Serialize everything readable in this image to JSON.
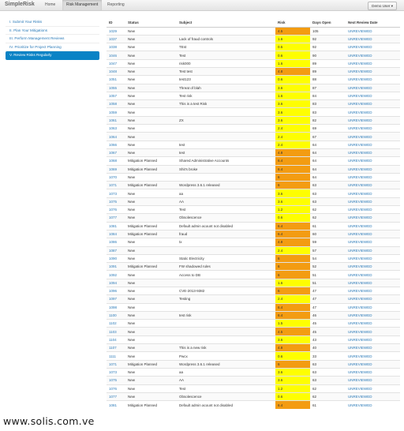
{
  "navbar": {
    "brand": "SimpleRisk",
    "tabs": [
      "Home",
      "Risk Management",
      "Reporting"
    ],
    "active_tab": "Risk Management",
    "user_button": "Demo User"
  },
  "sidebar": {
    "items": [
      {
        "label": "I. Submit Your Risks",
        "active": false
      },
      {
        "label": "II. Plan Your Mitigations",
        "active": false
      },
      {
        "label": "III. Perform Management Reviews",
        "active": false
      },
      {
        "label": "IV. Prioritize for Project Planning",
        "active": false
      },
      {
        "label": "V. Review Risks Regularly",
        "active": true
      }
    ]
  },
  "table": {
    "columns": [
      "ID",
      "Status",
      "Subject",
      "Risk",
      "Days Open",
      "Next Review Date"
    ],
    "rows": [
      [
        "1029",
        "New",
        "",
        "4.5",
        "105",
        "UNREVIEWED"
      ],
      [
        "1037",
        "New",
        "Lack of fraud controls",
        "1.6",
        "92",
        "UNREVIEWED"
      ],
      [
        "1038",
        "New",
        "TEst",
        "0.5",
        "92",
        "UNREVIEWED"
      ],
      [
        "1046",
        "New",
        "Test",
        "0.6",
        "90",
        "UNREVIEWED"
      ],
      [
        "1047",
        "New",
        "risk000",
        "1.6",
        "89",
        "UNREVIEWED"
      ],
      [
        "1048",
        "New",
        "Test test",
        "4.8",
        "89",
        "UNREVIEWED"
      ],
      [
        "1051",
        "New",
        "test123",
        "0.6",
        "88",
        "UNREVIEWED"
      ],
      [
        "1055",
        "New",
        "Threat of blah",
        "3.6",
        "87",
        "UNREVIEWED"
      ],
      [
        "1057",
        "New",
        "Test risk",
        "1.6",
        "84",
        "UNREVIEWED"
      ],
      [
        "1058",
        "New",
        "This is a test Risk",
        "3.6",
        "83",
        "UNREVIEWED"
      ],
      [
        "1059",
        "New",
        "",
        "3.6",
        "83",
        "UNREVIEWED"
      ],
      [
        "1061",
        "New",
        "ZX",
        "3.6",
        "82",
        "UNREVIEWED"
      ],
      [
        "1063",
        "New",
        "",
        "2.4",
        "69",
        "UNREVIEWED"
      ],
      [
        "1064",
        "New",
        "",
        "2.4",
        "67",
        "UNREVIEWED"
      ],
      [
        "1066",
        "New",
        "test",
        "2.4",
        "64",
        "UNREVIEWED"
      ],
      [
        "1067",
        "New",
        "test",
        "4.8",
        "64",
        "UNREVIEWED"
      ],
      [
        "1068",
        "Mitigation Planned",
        "Shared Administrative Accounts",
        "6.4",
        "64",
        "UNREVIEWED"
      ],
      [
        "1069",
        "Mitigation Planned",
        "Shit's broke",
        "6.4",
        "64",
        "UNREVIEWED"
      ],
      [
        "1070",
        "New",
        "",
        "6",
        "64",
        "UNREVIEWED"
      ],
      [
        "1071",
        "Mitigation Planned",
        "Wordpress 3.6.1 released",
        "6",
        "63",
        "UNREVIEWED"
      ],
      [
        "1073",
        "New",
        "aa",
        "3.6",
        "63",
        "UNREVIEWED"
      ],
      [
        "1075",
        "New",
        "AA",
        "3.6",
        "63",
        "UNREVIEWED"
      ],
      [
        "1076",
        "New",
        "Test",
        "1.2",
        "62",
        "UNREVIEWED"
      ],
      [
        "1077",
        "New",
        "Obsolescence",
        "0.6",
        "62",
        "UNREVIEWED"
      ],
      [
        "1081",
        "Mitigation Planned",
        "Default admin acount not disabled",
        "6.4",
        "61",
        "UNREVIEWED"
      ],
      [
        "1084",
        "Mitigation Planned",
        "fraud",
        "6.4",
        "60",
        "UNREVIEWED"
      ],
      [
        "1086",
        "New",
        "tx",
        "4.8",
        "59",
        "UNREVIEWED"
      ],
      [
        "1087",
        "New",
        "",
        "2.4",
        "57",
        "UNREVIEWED"
      ],
      [
        "1090",
        "New",
        "Static Electricity",
        "6",
        "54",
        "UNREVIEWED"
      ],
      [
        "1091",
        "Mitigation Planned",
        "FW shadowed rules",
        "6",
        "52",
        "UNREVIEWED"
      ],
      [
        "1092",
        "New",
        "Access to DB",
        "6",
        "51",
        "UNREVIEWED"
      ],
      [
        "1094",
        "New",
        "",
        "1.6",
        "51",
        "UNREVIEWED"
      ],
      [
        "1096",
        "New",
        "CVE-2013-9382",
        "6",
        "47",
        "UNREVIEWED"
      ],
      [
        "1097",
        "New",
        "Testing",
        "2.4",
        "47",
        "UNREVIEWED"
      ],
      [
        "1098",
        "New",
        "",
        "6.4",
        "47",
        "UNREVIEWED"
      ],
      [
        "1100",
        "New",
        "test risk",
        "6.4",
        "46",
        "UNREVIEWED"
      ],
      [
        "1102",
        "New",
        "",
        "1.5",
        "45",
        "UNREVIEWED"
      ],
      [
        "1103",
        "New",
        "",
        "4.5",
        "45",
        "UNREVIEWED"
      ],
      [
        "1104",
        "New",
        "",
        "3.6",
        "43",
        "UNREVIEWED"
      ],
      [
        "1107",
        "New",
        "This is a new risk",
        "4.8",
        "40",
        "UNREVIEWED"
      ],
      [
        "1111",
        "New",
        "Pwcx",
        "0.6",
        "33",
        "UNREVIEWED"
      ],
      [
        "1071",
        "Mitigation Planned",
        "Wordpress 3.6.1 released",
        "6",
        "63",
        "UNREVIEWED"
      ],
      [
        "1073",
        "New",
        "aa",
        "3.6",
        "63",
        "UNREVIEWED"
      ],
      [
        "1075",
        "New",
        "AA",
        "3.6",
        "63",
        "UNREVIEWED"
      ],
      [
        "1076",
        "New",
        "Test",
        "1.2",
        "62",
        "UNREVIEWED"
      ],
      [
        "1077",
        "New",
        "Obsolescence",
        "0.6",
        "62",
        "UNREVIEWED"
      ],
      [
        "1081",
        "Mitigation Planned",
        "Default admin acount not disabled",
        "6.4",
        "61",
        "UNREVIEWED"
      ]
    ]
  },
  "colors": {
    "high_risk": "#f39c12",
    "medium_risk": "#fefe00",
    "link": "#2a7ab8",
    "active_nav": "#0a83c5"
  },
  "footer": {
    "watermark": "www.solis.com.ve"
  }
}
